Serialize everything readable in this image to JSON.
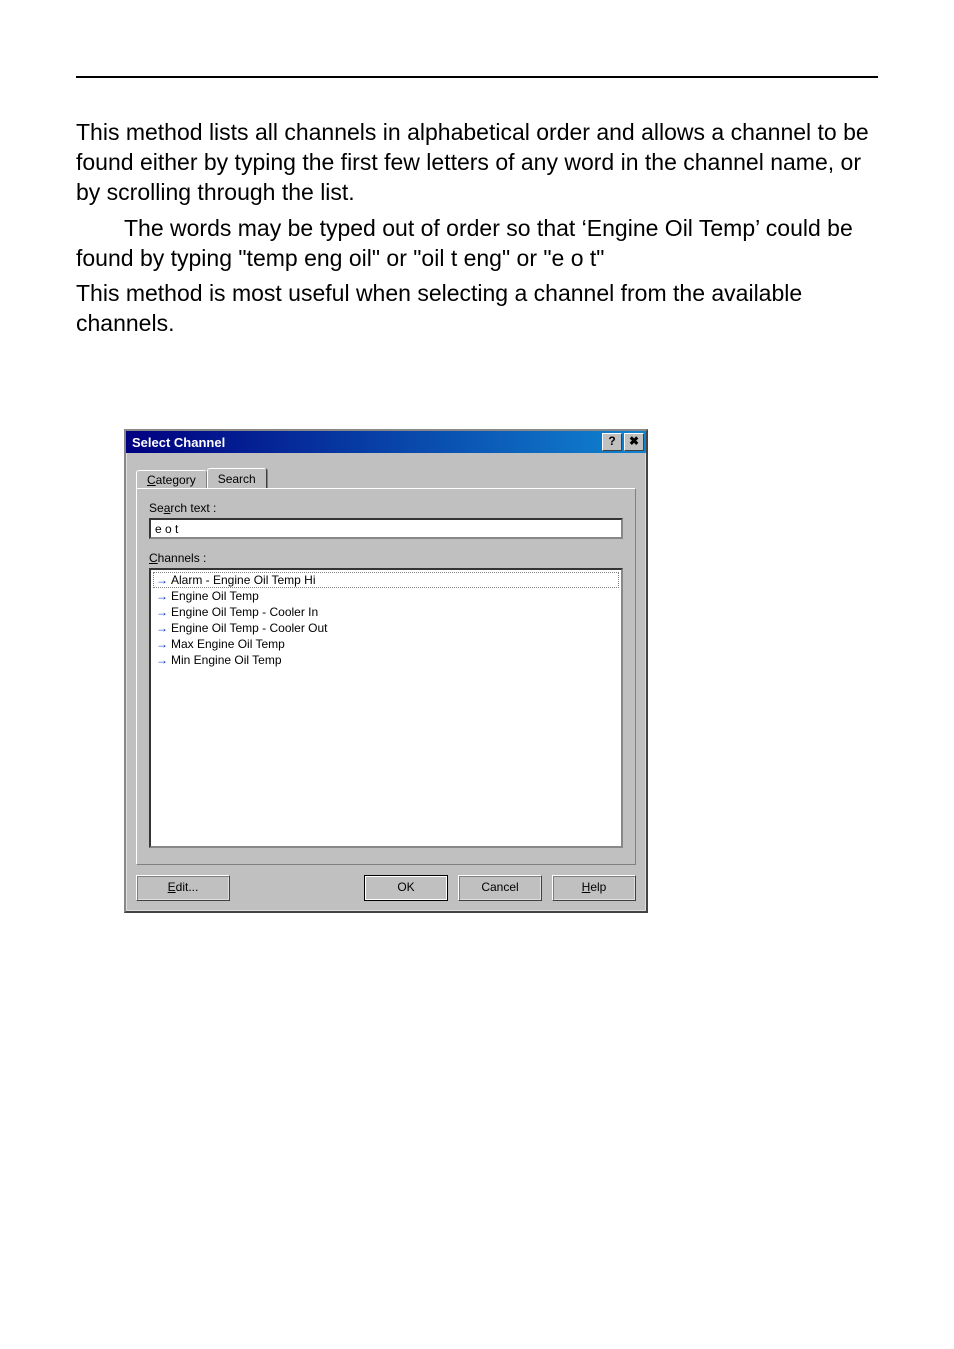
{
  "doc": {
    "p1": "This method lists all channels in alphabetical order and allows a channel to be found either by typing the first few letters of any word in the channel name, or by scrolling through the list.",
    "p2": "The words may be typed out of order so that ‘Engine Oil Temp’ could be found by typing \"temp eng oil\" or \"oil t eng\" or \"e o t\"",
    "p3": "This method is most useful when selecting a channel from the available channels."
  },
  "dialog": {
    "title": "Select Channel",
    "titlebar": {
      "help_glyph": "?",
      "close_glyph": "✖"
    },
    "tabs": {
      "category": "Category",
      "search": "Search"
    },
    "search_label_pre": "Se",
    "search_label_u": "a",
    "search_label_post": "rch text :",
    "search_value": "e o t",
    "channels_label_u": "C",
    "channels_label_post": "hannels :",
    "channels": [
      "Alarm - Engine Oil Temp Hi",
      "Engine Oil Temp",
      "Engine Oil Temp - Cooler In",
      "Engine Oil Temp - Cooler Out",
      "Max Engine Oil Temp",
      "Min Engine Oil Temp"
    ],
    "buttons": {
      "edit_u": "E",
      "edit_post": "dit...",
      "ok": "OK",
      "cancel": "Cancel",
      "help_u": "H",
      "help_post": "elp"
    }
  }
}
